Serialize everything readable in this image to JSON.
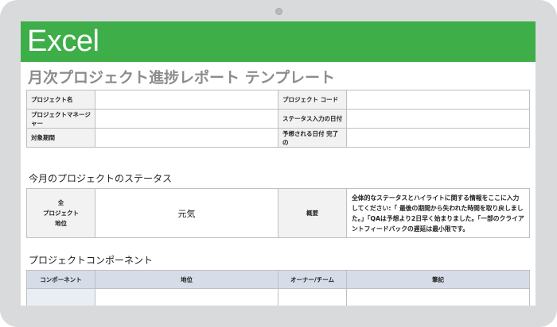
{
  "app": {
    "name": "Excel",
    "brand_color": "#3eae49"
  },
  "document": {
    "title": "月次プロジェクト進捗レポート テンプレート"
  },
  "project_info": {
    "project_name_label": "プロジェクト名",
    "project_code_label": "プロジェクト コード",
    "project_manager_label": "プロジェクトマネージャー",
    "status_date_label": "ステータス入力の日付",
    "period_label": "対象期間",
    "expected_end_label": "予想される日付 完了の",
    "project_name_value": "",
    "project_code_value": "",
    "project_manager_value": "",
    "status_date_value": "",
    "period_value": "",
    "expected_end_value": ""
  },
  "status_section": {
    "title": "今月のプロジェクトのステータス",
    "overall_label": "全\nプロジェクト\n地位",
    "overall_value": "元気",
    "summary_label": "概要",
    "summary_text": "全体的なステータスとハイライトに関する情報をここに入力してください:「 最後の期間から失われた時間を取り戻しました。」「QAは予想より2日早く始まりました。「一部のクライアントフィードバックの遅延は最小限です。"
  },
  "components_section": {
    "title": "プロジェクトコンポーネント",
    "headers": [
      "コンポーネント",
      "地位",
      "オーナー/チーム",
      "筆記"
    ],
    "rows": [
      [
        "",
        "",
        "",
        ""
      ]
    ]
  }
}
